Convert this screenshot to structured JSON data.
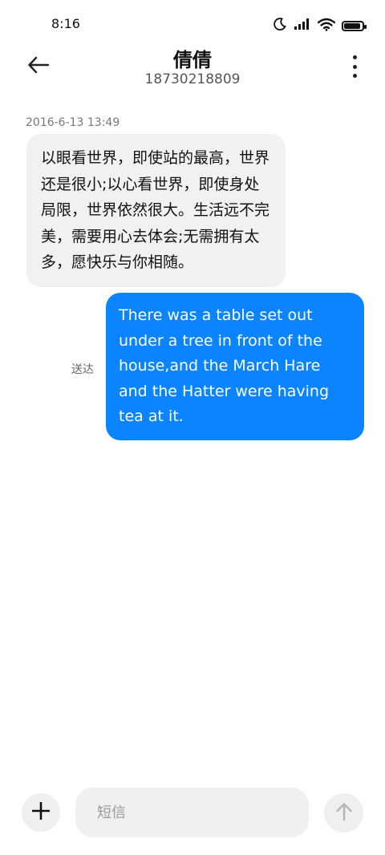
{
  "status_bar": {
    "time": "8:16",
    "icons": [
      "moon-icon",
      "signal-icon",
      "wifi-icon",
      "battery-icon"
    ],
    "battery_level": 0.9
  },
  "header": {
    "back_icon": "arrow-left-icon",
    "contact_name": "倩倩",
    "contact_number": "18730218809",
    "more_icon": "more-vertical-icon"
  },
  "conversation": {
    "timestamp": "2016-6-13 13:49",
    "incoming_message": "以眼看世界，即使站的最高，世界还是很小;以心看世界，即使身处局限，世界依然很大。生活远不完美，需要用心去体会;无需拥有太多，愿快乐与你相随。",
    "outgoing_message": "There was a table set out under a tree in front of the house,and the March Hare and the Hatter were having tea at it.",
    "delivery_status": "送达"
  },
  "composer": {
    "add_icon": "plus-icon",
    "placeholder": "短信",
    "send_icon": "arrow-up-icon"
  },
  "colors": {
    "outgoing_bubble": "#0a84ff",
    "incoming_bubble": "#f1f1f1",
    "background": "#ffffff"
  }
}
